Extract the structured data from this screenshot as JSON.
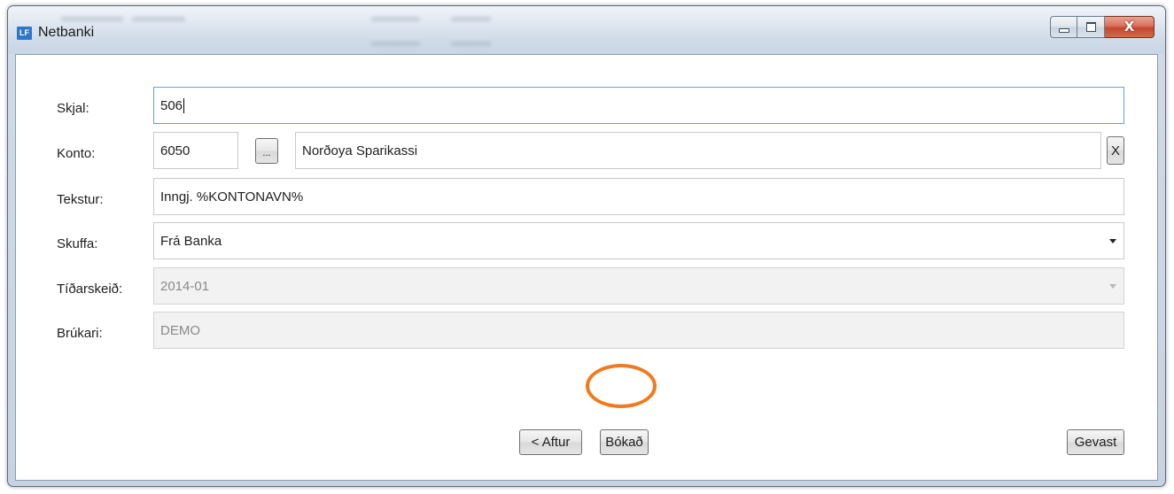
{
  "window": {
    "icon_text": "LF",
    "title": "Netbanki",
    "controls": {
      "minimize": "",
      "maximize": "",
      "close": "X"
    }
  },
  "form": {
    "skjal": {
      "label": "Skjal:",
      "value": "506"
    },
    "konto": {
      "label": "Konto:",
      "number": "6050",
      "browse_label": "...",
      "name": "Norðoya Sparikassi",
      "clear_label": "X"
    },
    "tekstur": {
      "label": "Tekstur:",
      "value": "Inngj. %KONTONAVN%"
    },
    "skuffa": {
      "label": "Skuffa:",
      "value": "Frá Banka"
    },
    "tidarskeid": {
      "label": "Tíðarskeið:",
      "value": "2014-01"
    },
    "brukari": {
      "label": "Brúkari:",
      "value": "DEMO"
    }
  },
  "buttons": {
    "back": "< Aftur",
    "book": "Bókað",
    "cancel": "Gevast"
  },
  "colors": {
    "highlight_ring": "#f07a1c",
    "focus_border": "#6a9ed4",
    "app_icon": "#2f78c9"
  }
}
